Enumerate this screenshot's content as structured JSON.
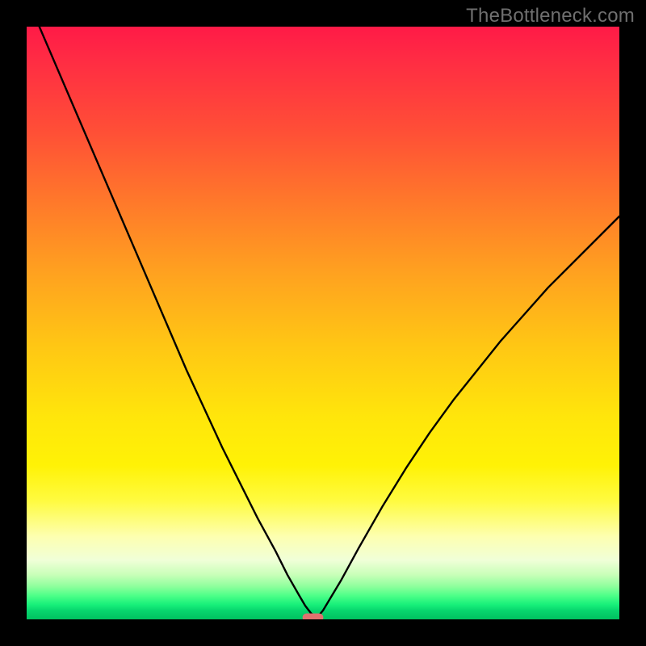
{
  "watermark": "TheBottleneck.com",
  "chart_data": {
    "type": "line",
    "title": "",
    "xlabel": "",
    "ylabel": "",
    "xlim": [
      0,
      100
    ],
    "ylim": [
      0,
      100
    ],
    "grid": false,
    "legend": false,
    "annotations": [],
    "series": [
      {
        "name": "bottleneck-curve",
        "x": [
          0,
          3,
          6,
          9,
          12,
          15,
          18,
          21,
          24,
          27,
          30,
          33,
          36,
          39,
          42,
          44,
          46,
          47,
          48,
          49,
          50,
          53,
          56,
          60,
          64,
          68,
          72,
          76,
          80,
          84,
          88,
          92,
          96,
          100
        ],
        "values": [
          105,
          98,
          91,
          84,
          77,
          70,
          63,
          56,
          49,
          42,
          35.5,
          29,
          23,
          17,
          11.5,
          7.5,
          4,
          2.3,
          1,
          0.3,
          1.5,
          6.5,
          12,
          19,
          25.5,
          31.5,
          37,
          42,
          47,
          51.5,
          56,
          60,
          64,
          68
        ]
      }
    ],
    "minimum_marker": {
      "x": 48.3,
      "y": 0.3,
      "width": 3.5,
      "height": 1.4
    },
    "gradient_stops": [
      {
        "pos": 0.0,
        "color": "#ff1a47"
      },
      {
        "pos": 0.3,
        "color": "#ff7a2a"
      },
      {
        "pos": 0.66,
        "color": "#ffe60b"
      },
      {
        "pos": 0.9,
        "color": "#f0ffd8"
      },
      {
        "pos": 1.0,
        "color": "#00c060"
      }
    ]
  }
}
